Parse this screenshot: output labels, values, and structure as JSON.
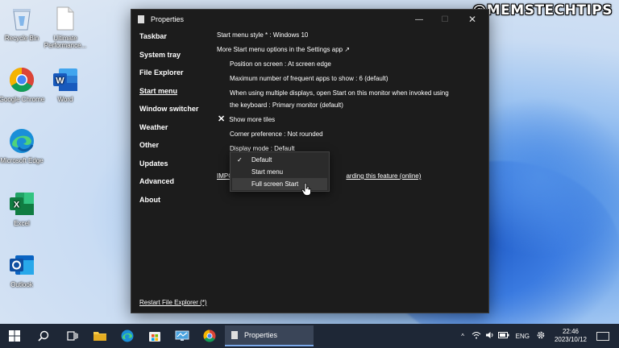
{
  "watermark": "@MEMSTECHTIPS",
  "desktop": {
    "icons": [
      {
        "name": "recycle-bin",
        "label": "Recycle Bin"
      },
      {
        "name": "ultimate-performance",
        "label": "Ultimate Performance..."
      },
      {
        "name": "google-chrome",
        "label": "Google Chrome"
      },
      {
        "name": "word",
        "label": "Word"
      },
      {
        "name": "microsoft-edge",
        "label": "Microsoft Edge"
      },
      {
        "name": "excel",
        "label": "Excel"
      },
      {
        "name": "outlook",
        "label": "Outlook"
      }
    ]
  },
  "window": {
    "title": "Properties",
    "controls": {
      "minimize": "—",
      "maximize": "☐",
      "close": "✕"
    },
    "sidebar": {
      "items": [
        {
          "label": "Taskbar"
        },
        {
          "label": "System tray"
        },
        {
          "label": "File Explorer"
        },
        {
          "label": "Start menu"
        },
        {
          "label": "Window switcher"
        },
        {
          "label": "Weather"
        },
        {
          "label": "Other"
        },
        {
          "label": "Updates"
        },
        {
          "label": "Advanced"
        },
        {
          "label": "About"
        }
      ],
      "active": "Start menu",
      "restart_link": "Restart File Explorer (*)"
    },
    "content": {
      "start_menu_style": "Start menu style * : Windows 10",
      "more_options_link": "More Start menu options in the Settings app ↗",
      "position": "Position on screen : At screen edge",
      "max_frequent": "Maximum number of frequent apps to show : 6 (default)",
      "multi_display_line1": "When using multiple displays, open Start on this monitor when invoked using",
      "multi_display_line2": "the keyboard : Primary monitor (default)",
      "show_more_tiles": "Show more tiles",
      "corner_preference": "Corner preference : Not rounded",
      "display_mode": "Display mode : Default",
      "important_prefix": "IMPO",
      "important_suffix": "arding this feature (online)"
    },
    "dropdown": {
      "items": [
        {
          "label": "Default",
          "checked": true
        },
        {
          "label": "Start menu",
          "checked": false
        },
        {
          "label": "Full screen Start",
          "checked": false,
          "hover": true
        }
      ],
      "check_glyph": "✓"
    }
  },
  "taskbar": {
    "active_app": "Properties",
    "tray": {
      "chevron": "^",
      "language": "ENG",
      "time": "22:46",
      "date": "2023/10/12"
    }
  },
  "colors": {
    "window_bg": "#1c1c1c",
    "taskbar_bg": "#1e2736",
    "accent": "#7aa7e8"
  }
}
